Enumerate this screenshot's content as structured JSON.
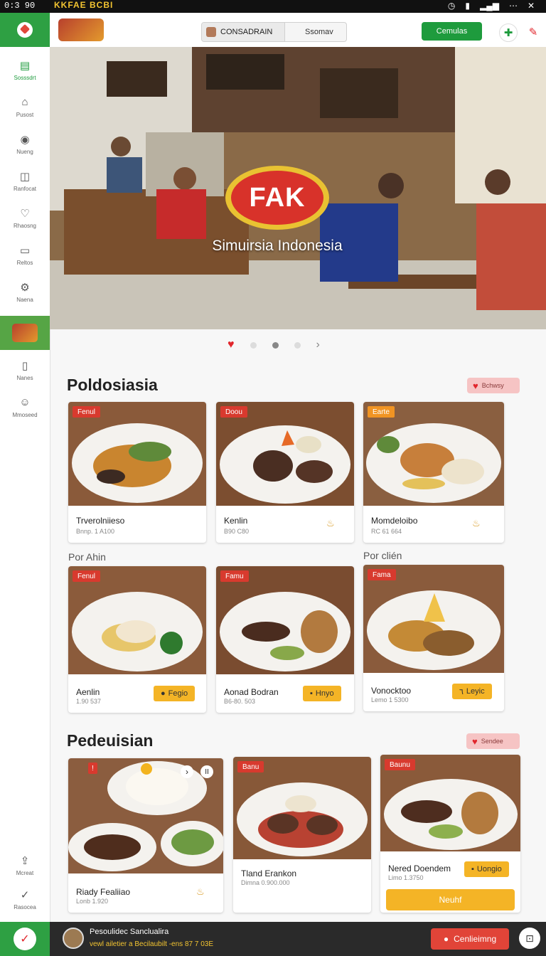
{
  "status_bar": {
    "time": "0:3 90",
    "brand": "KKFAE BCBI"
  },
  "header": {
    "brand_badge": "",
    "search_left": "CONSADRAIN",
    "search_right": "Ssomav",
    "action_button": "Cemulas"
  },
  "sidebar": {
    "items": [
      {
        "label": "Sosssdrt",
        "icon": "grid-icon"
      },
      {
        "label": "Pusost",
        "icon": "home-icon"
      },
      {
        "label": "Nueng",
        "icon": "cart-icon"
      },
      {
        "label": "Ranfocat",
        "icon": "chart-icon"
      },
      {
        "label": "Rhaosng",
        "icon": "heart-icon"
      },
      {
        "label": "Reltos",
        "icon": "card-icon"
      },
      {
        "label": "Naena",
        "icon": "gear-icon"
      },
      {
        "label": "Nanes",
        "icon": "info-icon"
      },
      {
        "label": "Mmoseed",
        "icon": "smile-icon"
      },
      {
        "label": "Mcreat",
        "icon": "upload-icon"
      },
      {
        "label": "Rasocea",
        "icon": "check-icon"
      }
    ]
  },
  "hero": {
    "logo_text": "FAK",
    "subtitle": "Simuirsia Indonesia"
  },
  "section1": {
    "title": "Poldosiasia",
    "pill": "Bchwsy",
    "row1": [
      {
        "tag": "Fenul",
        "name": "Trverolniieso",
        "price": "Bnnp. 1 A100"
      },
      {
        "tag": "Doou",
        "name": "Kenlin",
        "price": "B90 C80"
      },
      {
        "tag": "Earte",
        "name": "Momdeloibo",
        "price": "RC 61 664"
      }
    ],
    "sub_left": "Por Ahin",
    "sub_right": "Por clién",
    "row2": [
      {
        "tag": "Fenul",
        "name": "Aenlin",
        "price": "1.90 537",
        "button": "Fegio"
      },
      {
        "tag": "Famu",
        "name": "Aonad Bodran",
        "price": "B6-80. 503",
        "button": "Hnyo"
      },
      {
        "tag": "Fama",
        "name": "Vonocktoo",
        "price": "Lemo 1 5300",
        "button": "Leyic"
      }
    ]
  },
  "section2": {
    "title": "Pedeuisian",
    "pill": "Sendee",
    "row": [
      {
        "tag": "!",
        "name": "Riady Fealiiao",
        "price": "Lonb 1.920"
      },
      {
        "tag": "Banu",
        "name": "Tland Erankon",
        "price": "Dimna 0.900.000"
      },
      {
        "tag": "Baunu",
        "name": "Nered Doendem",
        "price": "Limo 1.3750",
        "button": "Uongio",
        "wide_button": "Neuhf"
      }
    ]
  },
  "bottom_bar": {
    "line1": "Pesoulidec  Sanclualira",
    "line2": "vewl   ailetier a  Becilaubilt  -ens  87  7 03E",
    "button": "Cenlieimng"
  },
  "colors": {
    "accent_green": "#2ea043",
    "accent_red": "#d8322a",
    "accent_yellow": "#f4b426"
  }
}
